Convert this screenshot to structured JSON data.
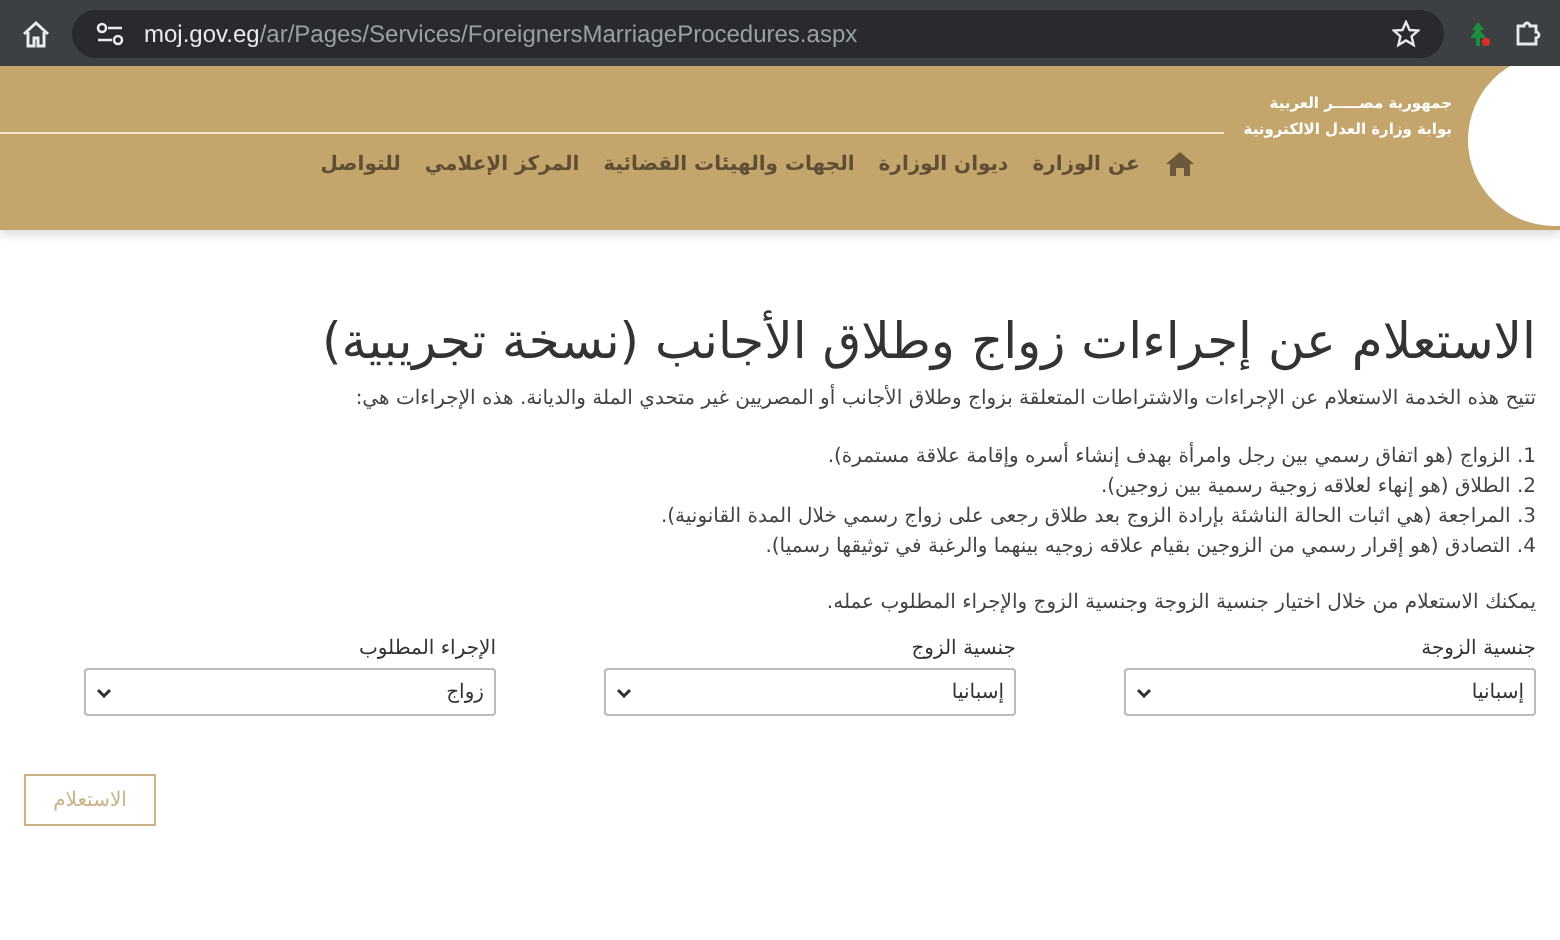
{
  "browser": {
    "url_host": "moj.gov.eg",
    "url_path": "/ar/Pages/Services/ForeignersMarriageProcedures.aspx"
  },
  "header": {
    "logo_lines": [
      "جمهورية مصـــــر العربية",
      "بوابة وزارة العدل الالكترونية"
    ],
    "nav": [
      {
        "label": "عن الوزارة"
      },
      {
        "label": "ديوان الوزارة"
      },
      {
        "label": "الجهات والهيئات القضائية"
      },
      {
        "label": "المركز الإعلامي"
      },
      {
        "label": "للتواصل"
      }
    ]
  },
  "title": "الاستعلام عن إجراءات زواج وطلاق الأجانب (نسخة تجريبية)",
  "intro": "تتيح هذه الخدمة الاستعلام عن الإجراءات والاشتراطات المتعلقة بزواج وطلاق الأجانب أو المصريين غير متحدي الملة والديانة. هذه الإجراءات هي:",
  "procedures": [
    "1. الزواج (هو اتفاق رسمي بين رجل وامرأة بهدف إنشاء أسره وإقامة علاقة مستمرة).",
    "2. الطلاق (هو إنهاء لعلاقه زوجية رسمية بين زوجين).",
    "3. المراجعة (هي اثبات الحالة الناشئة بإرادة الزوج بعد طلاق رجعى على زواج رسمي خلال المدة القانونية).",
    "4. التصادق (هو إقرار رسمي من الزوجين بقيام علاقه زوجيه بينهما والرغبة في توثيقها رسميا)."
  ],
  "hint": "يمكنك الاستعلام من خلال اختيار جنسية الزوجة وجنسية الزوج والإجراء المطلوب عمله.",
  "fields": [
    {
      "label": "جنسية الزوجة",
      "value": "إسبانيا"
    },
    {
      "label": "جنسية الزوج",
      "value": "إسبانيا"
    },
    {
      "label": "الإجراء المطلوب",
      "value": "زواج"
    }
  ],
  "submit": {
    "label": "الاستعلام",
    "disabled": true
  }
}
